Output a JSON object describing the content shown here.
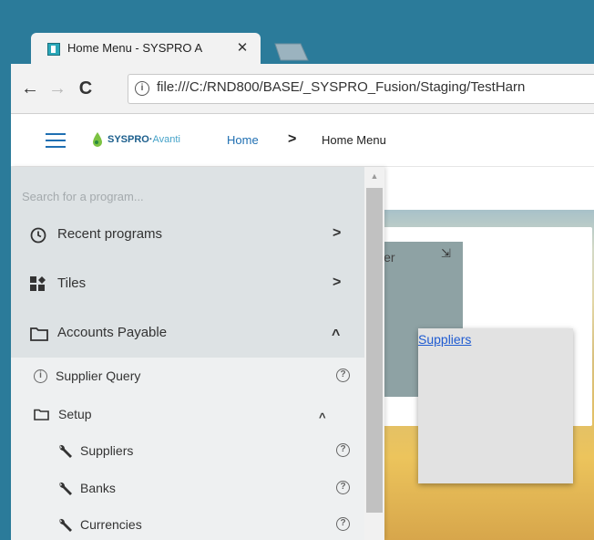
{
  "browser": {
    "tab_title": "Home Menu - SYSPRO A",
    "tab_close": "✕",
    "url": "file:///C:/RND800/BASE/_SYSPRO_Fusion/Staging/TestHarn",
    "back": "←",
    "forward": "→",
    "reload": "C",
    "info": "i"
  },
  "header": {
    "logo_main": "SYSPRO",
    "logo_sub": "Avanti",
    "breadcrumb": [
      "Home",
      "Home Menu"
    ],
    "breadcrumb_sep": ">"
  },
  "sidebar": {
    "search_placeholder": "Search for a program...",
    "top_items": [
      {
        "label": "Recent programs",
        "icon": "clock-icon",
        "chevron": ">"
      },
      {
        "label": "Tiles",
        "icon": "tiles-icon",
        "chevron": ">"
      },
      {
        "label": "Accounts Payable",
        "icon": "folder-icon",
        "chevron": "^"
      }
    ],
    "sub_items": [
      {
        "label": "Supplier Query",
        "icon": "info-icon",
        "help": "?"
      },
      {
        "label": "Setup",
        "icon": "folder-icon",
        "chevron": "^"
      },
      {
        "label": "Suppliers",
        "icon": "wrench-icon",
        "help": "?"
      },
      {
        "label": "Banks",
        "icon": "wrench-icon",
        "help": "?"
      },
      {
        "label": "Currencies",
        "icon": "wrench-icon",
        "help": "?"
      }
    ]
  },
  "content": {
    "tile_label": "ler",
    "tile_action_icon": "⇲",
    "popup_link": "Suppliers"
  },
  "colors": {
    "chrome_frame": "#2b7b9a",
    "accent": "#1f6fb2",
    "link": "#1f5bd1",
    "sidebar_bg": "#dde2e4",
    "tile_card": "#8ea2a4"
  }
}
